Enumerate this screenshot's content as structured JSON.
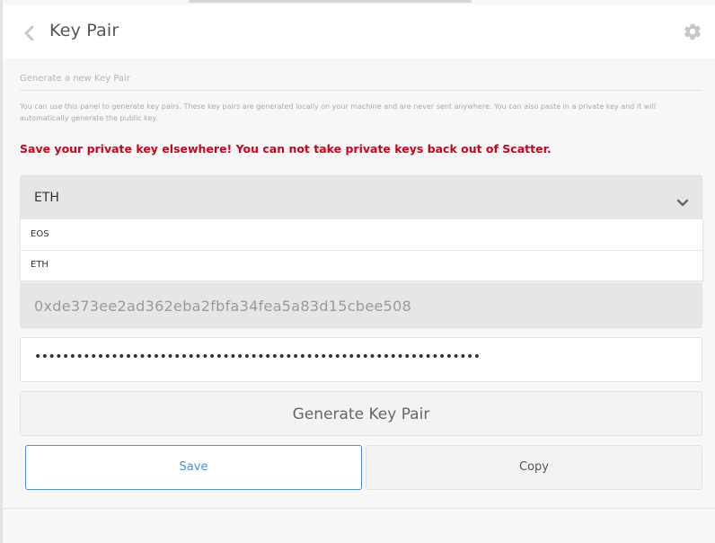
{
  "header": {
    "title": "Key Pair",
    "back_icon": "chevron-left-icon",
    "settings_icon": "gear-icon"
  },
  "panel": {
    "section_title": "Generate a new Key Pair",
    "description": "You can use this panel to generate key pairs. These key pairs are generated locally on your machine and are never sent anywhere. You can also paste in a private key and it will automatically generate the public key.",
    "warning": "Save your private key elsewhere! You can not take private keys back out of Scatter."
  },
  "blockchain_select": {
    "selected": "ETH",
    "options": [
      "EOS",
      "ETH"
    ]
  },
  "public_key": {
    "value": "0xde373ee2ad362eba2fbfa34fea5a83d15cbee508"
  },
  "private_key": {
    "value": "••••••••••••••••••••••••••••••••••••••••••••••••••••••••••••••••"
  },
  "buttons": {
    "generate": "Generate Key Pair",
    "save": "Save",
    "copy": "Copy"
  },
  "colors": {
    "accent": "#4a90e2",
    "warning": "#d0021b"
  }
}
